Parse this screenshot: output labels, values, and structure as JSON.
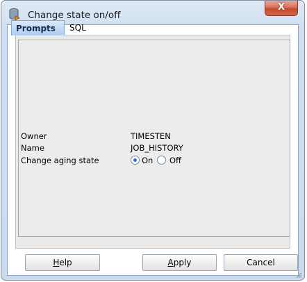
{
  "window": {
    "title": "Change state on/off",
    "close_glyph": "X"
  },
  "tabs": [
    {
      "label": "Prompts",
      "active": true
    },
    {
      "label": "SQL",
      "active": false
    }
  ],
  "form": {
    "owner_label": "Owner",
    "owner_value": "TIMESTEN",
    "name_label": "Name",
    "name_value": "JOB_HISTORY",
    "aging_label": "Change aging state",
    "options": [
      {
        "label": "On",
        "selected": true
      },
      {
        "label": "Off",
        "selected": false
      }
    ]
  },
  "buttons": {
    "help": {
      "mnemonic": "H",
      "rest": "elp"
    },
    "apply": {
      "mnemonic": "A",
      "rest": "pply"
    },
    "cancel": "Cancel"
  },
  "icons": {
    "app": "database-icon",
    "close": "close-icon",
    "grip": "resize-grip-icon"
  },
  "colors": {
    "active_tab": "#aecdf0",
    "close_button": "#c44a30",
    "panel": "#eaeaea"
  }
}
